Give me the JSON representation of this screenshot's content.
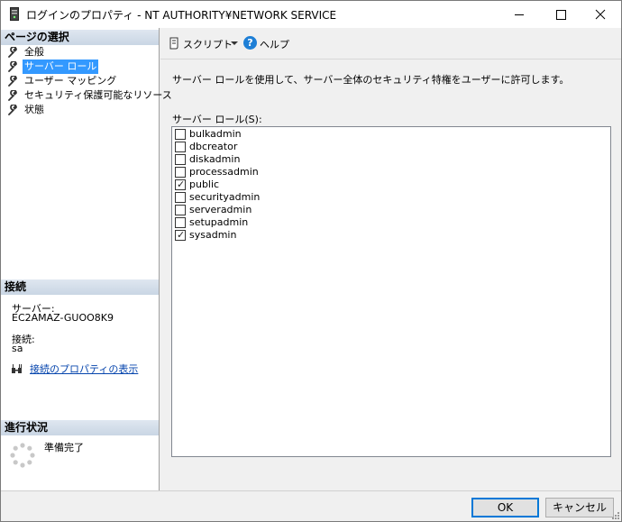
{
  "window": {
    "title": "ログインのプロパティ - NT AUTHORITY¥NETWORK SERVICE"
  },
  "left_pane": {
    "page_select_header": "ページの選択",
    "pages": [
      {
        "label": "全般",
        "selected": false
      },
      {
        "label": "サーバー ロール",
        "selected": true
      },
      {
        "label": "ユーザー マッピング",
        "selected": false
      },
      {
        "label": "セキュリティ保護可能なリソース",
        "selected": false
      },
      {
        "label": "状態",
        "selected": false
      }
    ],
    "connection_header": "接続",
    "server_label": "サーバー:",
    "server_value": "EC2AMAZ-GUOO8K9",
    "connection_label": "接続:",
    "connection_value": "sa",
    "view_connection_link": "接続のプロパティの表示",
    "progress_header": "進行状況",
    "progress_status": "準備完了"
  },
  "toolbar": {
    "script_label": "スクリプト",
    "help_label": "ヘルプ"
  },
  "main": {
    "description": "サーバー ロールを使用して、サーバー全体のセキュリティ特権をユーザーに許可します。",
    "roles_label": "サーバー ロール(S):",
    "roles": [
      {
        "name": "bulkadmin",
        "checked": false
      },
      {
        "name": "dbcreator",
        "checked": false
      },
      {
        "name": "diskadmin",
        "checked": false
      },
      {
        "name": "processadmin",
        "checked": false
      },
      {
        "name": "public",
        "checked": true
      },
      {
        "name": "securityadmin",
        "checked": false
      },
      {
        "name": "serveradmin",
        "checked": false
      },
      {
        "name": "setupadmin",
        "checked": false
      },
      {
        "name": "sysadmin",
        "checked": true
      }
    ]
  },
  "buttons": {
    "ok_label": "OK",
    "cancel_label": "キャンセル"
  },
  "colors": {
    "selection": "#3399ff",
    "section_header": "#dfe7f0",
    "link": "#0645ad",
    "help_icon": "#1e7fd6"
  }
}
